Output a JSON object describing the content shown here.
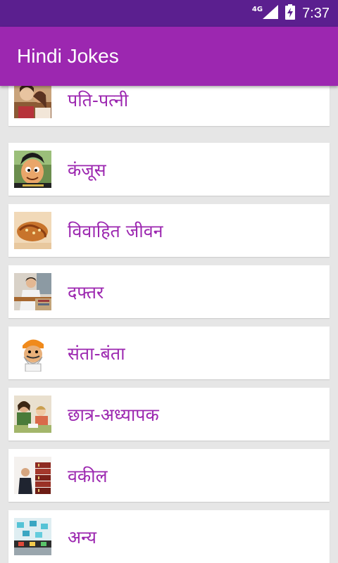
{
  "status_bar": {
    "network": "4G",
    "time": "7:37"
  },
  "app_bar": {
    "title": "Hindi Jokes"
  },
  "categories": [
    {
      "label": "पति-पत्नी",
      "icon": "couple-photo-icon"
    },
    {
      "label": "कंजूस",
      "icon": "cartoon-man-icon"
    },
    {
      "label": "विवाहित जीवन",
      "icon": "wedding-hands-icon"
    },
    {
      "label": "दफ्तर",
      "icon": "office-worker-icon"
    },
    {
      "label": "संता-बंता",
      "icon": "sardar-cartoon-icon"
    },
    {
      "label": "छात्र-अध्यापक",
      "icon": "classroom-icon"
    },
    {
      "label": "वकील",
      "icon": "lawyer-books-icon"
    },
    {
      "label": "अन्य",
      "icon": "misc-icon"
    }
  ]
}
